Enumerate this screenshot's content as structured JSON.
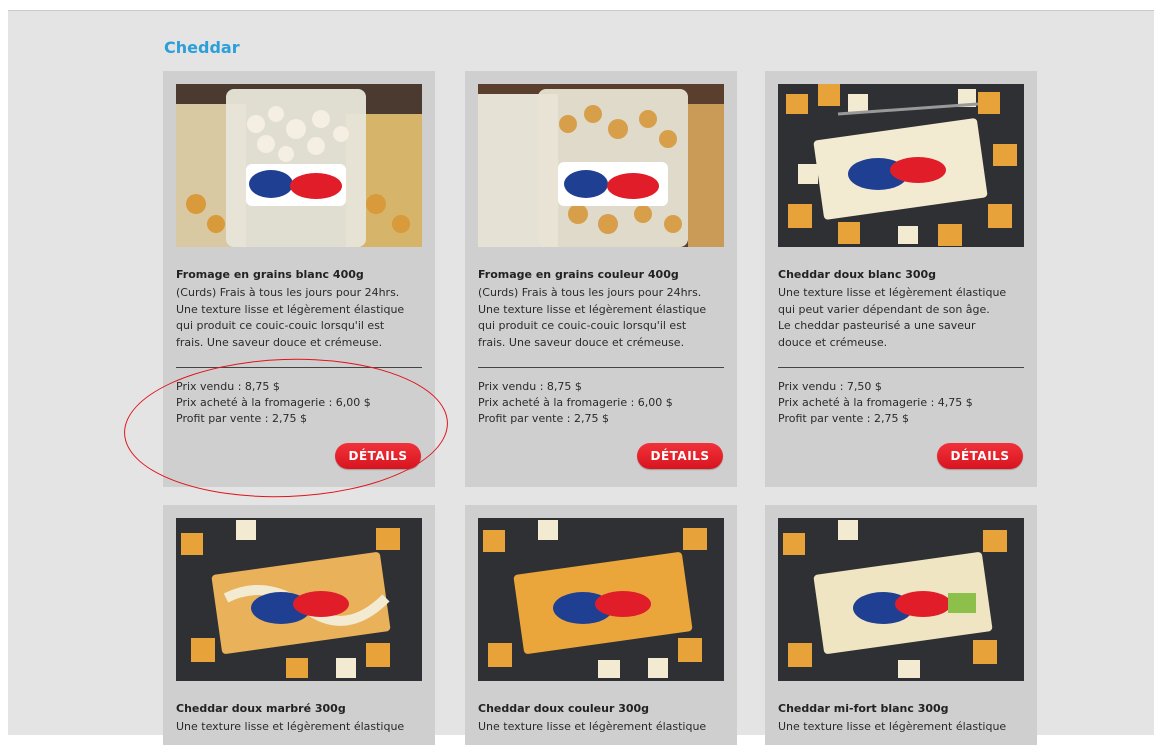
{
  "section": {
    "title": "Cheddar"
  },
  "colors": {
    "accent": "#2b9fd9",
    "button": "#e51c25",
    "annotation": "#e0141c"
  },
  "products": [
    {
      "name": "Fromage en grains blanc 400g",
      "desc_lines": [
        "(Curds) Frais à tous les jours pour 24hrs.",
        "Une texture lisse et légèrement élastique",
        "qui produit ce couic-couic lorsqu'il est",
        "frais. Une saveur douce et crémeuse."
      ],
      "price_sold": "Prix vendu : 8,75 $",
      "price_bought": "Prix acheté à la fromagerie : 6,00 $",
      "profit": "Profit par vente : 2,75 $",
      "details_label": "DÉTAILS",
      "image_icon": "cheese-curds-bag-white"
    },
    {
      "name": "Fromage en grains couleur 400g",
      "desc_lines": [
        "(Curds) Frais à tous les jours pour 24hrs.",
        "Une texture lisse et légèrement élastique",
        "qui produit ce couic-couic lorsqu'il est",
        "frais. Une saveur douce et crémeuse."
      ],
      "price_sold": "Prix vendu : 8,75 $",
      "price_bought": "Prix acheté à la fromagerie : 6,00 $",
      "profit": "Profit par vente : 2,75 $",
      "details_label": "DÉTAILS",
      "image_icon": "cheese-curds-bag-colour"
    },
    {
      "name": "Cheddar doux blanc 300g",
      "desc_lines": [
        "Une texture lisse et légèrement élastique",
        "qui peut varier dépendant de son âge.",
        "Le cheddar pasteurisé a une saveur",
        "douce et crémeuse."
      ],
      "price_sold": "Prix vendu : 7,50 $",
      "price_bought": "Prix acheté à la fromagerie : 4,75 $",
      "profit": "Profit par vente : 2,75 $",
      "details_label": "DÉTAILS",
      "image_icon": "cheddar-block-white"
    },
    {
      "name": "Cheddar doux marbré 300g",
      "desc_lines": [
        "Une texture lisse et légèrement élastique"
      ],
      "image_icon": "cheddar-block-marble"
    },
    {
      "name": "Cheddar doux couleur 300g",
      "desc_lines": [
        "Une texture lisse et légèrement élastique"
      ],
      "image_icon": "cheddar-block-colour"
    },
    {
      "name": "Cheddar mi-fort blanc 300g",
      "desc_lines": [
        "Une texture lisse et légèrement élastique"
      ],
      "image_icon": "cheddar-block-mild-white"
    }
  ]
}
